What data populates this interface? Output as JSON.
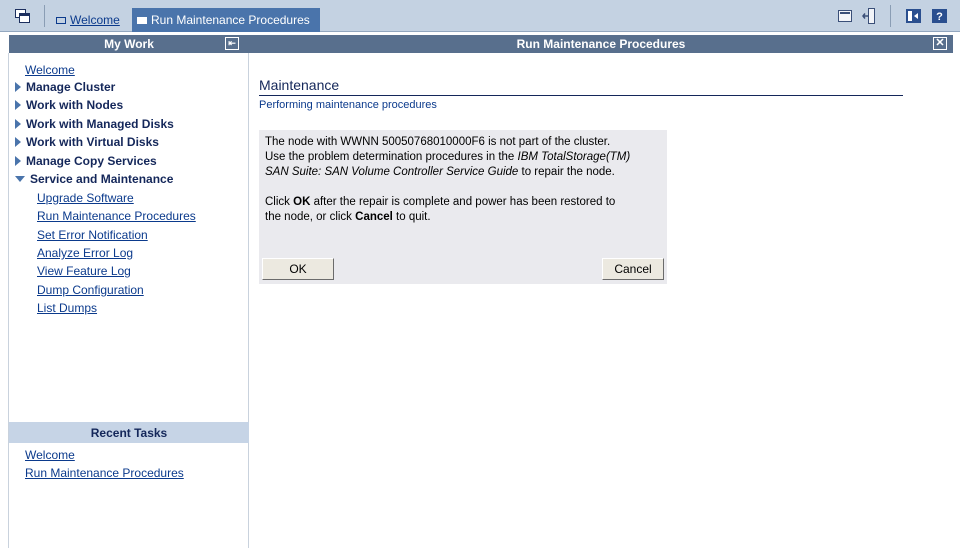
{
  "tabs": [
    {
      "label": "Welcome"
    },
    {
      "label": "Run Maintenance Procedures"
    }
  ],
  "icons": {
    "task_manager": "task-manager-icon",
    "tab_page": "page-icon",
    "my_info": "my-information-icon",
    "logout": "logout-icon",
    "navigator": "navigator-toggle-icon",
    "help": "help-icon",
    "collapse": "collapse-icon",
    "close": "close-icon",
    "expand": "triangle-right-icon",
    "expanded": "triangle-down-icon"
  },
  "colors": {
    "banner": "#c4d2e2",
    "active_tab": "#4a74ab",
    "header_bar": "#586f8d",
    "recent_header": "#c6d4e6",
    "link": "#0b3a8c",
    "panel_bg": "#eaeaee"
  },
  "my_work": {
    "title": "My Work",
    "welcome": "Welcome",
    "groups": [
      {
        "label": "Manage Cluster",
        "expanded": false
      },
      {
        "label": "Work with Nodes",
        "expanded": false
      },
      {
        "label": "Work with Managed Disks",
        "expanded": false
      },
      {
        "label": "Work with Virtual Disks",
        "expanded": false
      },
      {
        "label": "Manage Copy Services",
        "expanded": false
      },
      {
        "label": "Service and Maintenance",
        "expanded": true
      }
    ],
    "service_items": [
      "Upgrade Software",
      "Run Maintenance Procedures",
      "Set Error Notification",
      "Analyze Error Log",
      "View Feature Log",
      "Dump Configuration",
      "List Dumps"
    ]
  },
  "recent_tasks": {
    "title": "Recent Tasks",
    "items": [
      "Welcome",
      "Run Maintenance Procedures"
    ]
  },
  "content": {
    "header": "Run Maintenance Procedures",
    "title": "Maintenance",
    "subtitle": "Performing maintenance procedures",
    "message": {
      "line1": "The node with WWNN 50050768010000F6 is not part of the cluster.",
      "line2_prefix": "Use the problem determination procedures in the ",
      "guide_title_1": "IBM TotalStorage(TM)",
      "guide_title_2": "SAN Suite: SAN Volume Controller Service Guide",
      "line3_suffix": " to repair the node.",
      "p2_click": "Click ",
      "p2_ok": "OK",
      "p2_mid": " after the repair is complete and power has been restored to",
      "p2_line2_prefix": "the node, or click ",
      "p2_cancel": "Cancel",
      "p2_end": " to quit."
    },
    "buttons": {
      "ok": "OK",
      "cancel": "Cancel"
    }
  }
}
